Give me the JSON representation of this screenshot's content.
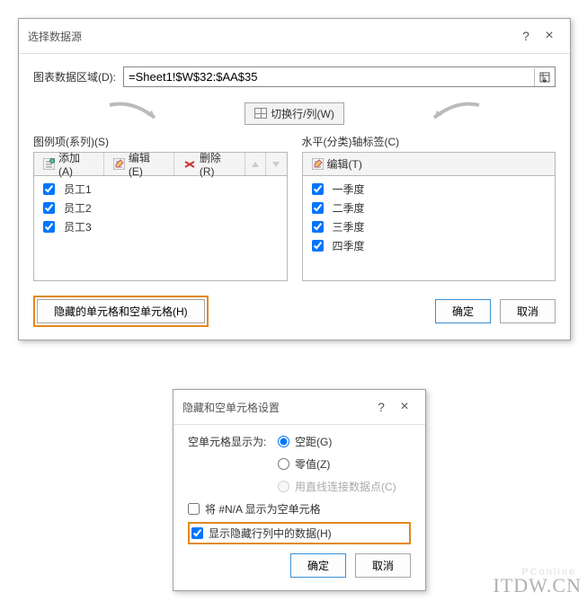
{
  "dialog1": {
    "title": "选择数据源",
    "range_label": "图表数据区域(D):",
    "range_value": "=Sheet1!$W$32:$AA$35",
    "swap_label": "切换行/列(W)",
    "series": {
      "title": "图例项(系列)(S)",
      "add": "添加(A)",
      "edit": "编辑(E)",
      "del": "删除(R)",
      "items": [
        "员工1",
        "员工2",
        "员工3"
      ]
    },
    "categories": {
      "title": "水平(分类)轴标签(C)",
      "edit": "编辑(T)",
      "items": [
        "一季度",
        "二季度",
        "三季度",
        "四季度"
      ]
    },
    "hidden_btn": "隐藏的单元格和空单元格(H)",
    "ok": "确定",
    "cancel": "取消"
  },
  "dialog2": {
    "title": "隐藏和空单元格设置",
    "display_label": "空单元格显示为:",
    "opt_gap": "空距(G)",
    "opt_zero": "零值(Z)",
    "opt_line": "用直线连接数据点(C)",
    "show_na": "将 #N/A 显示为空单元格",
    "show_hidden": "显示隐藏行列中的数据(H)",
    "ok": "确定",
    "cancel": "取消"
  },
  "watermark": "ITDW.CN",
  "faint": "PConline"
}
